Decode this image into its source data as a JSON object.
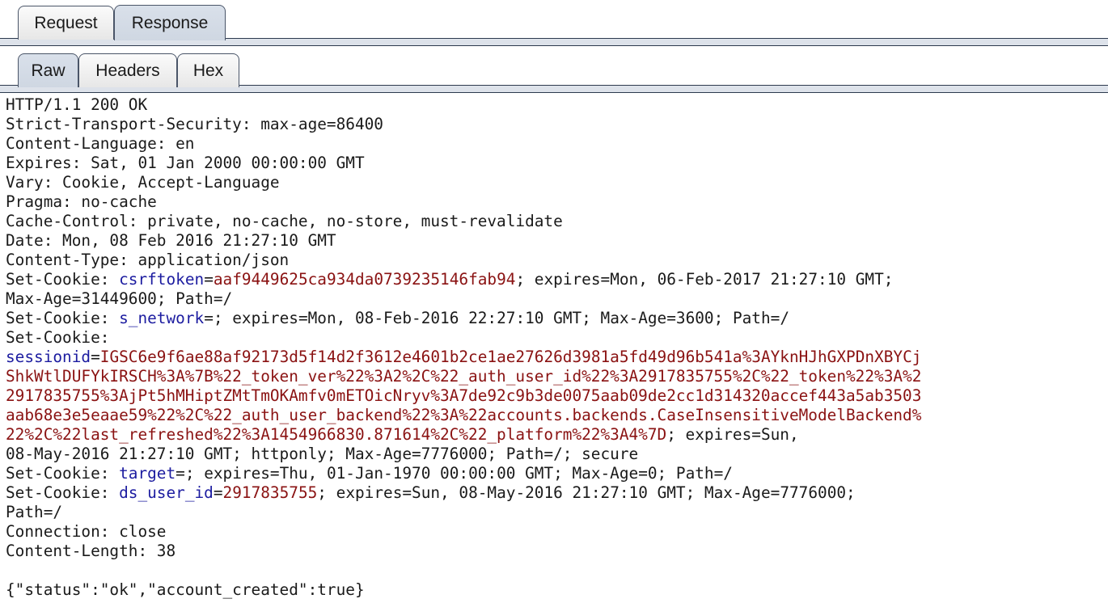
{
  "tabs": {
    "main": [
      "Request",
      "Response"
    ],
    "main_selected": "Response",
    "view": [
      "Raw",
      "Headers",
      "Hex"
    ],
    "view_selected": "Raw"
  },
  "colors": {
    "cookie_name": "#1c1ca0",
    "cookie_value": "#8a1212",
    "selected_tab": "#d3dae4"
  },
  "response": {
    "status_line": "HTTP/1.1 200 OK",
    "headers_before_cookies": [
      "Strict-Transport-Security: max-age=86400",
      "Content-Language: en",
      "Expires: Sat, 01 Jan 2000 00:00:00 GMT",
      "Vary: Cookie, Accept-Language",
      "Pragma: no-cache",
      "Cache-Control: private, no-cache, no-store, must-revalidate",
      "Date: Mon, 08 Feb 2016 21:27:10 GMT",
      "Content-Type: application/json"
    ],
    "set_cookie_prefix": "Set-Cookie:",
    "cookies": [
      {
        "name": "csrftoken",
        "value": "aaf9449625ca934da0739235146fab94",
        "attributes": "; expires=Mon, 06-Feb-2017 21:27:10 GMT; Max-Age=31449600; Path=/"
      },
      {
        "name": "s_network",
        "value": "",
        "attributes": "; expires=Mon, 08-Feb-2016 22:27:10 GMT; Max-Age=3600; Path=/"
      },
      {
        "name": "sessionid",
        "value": "IGSC6e9f6ae88af92173d5f14d2f3612e4601b2ce1ae27626d3981a5fd49d96b541a%3AYknHJhGXPDnXBYCjShkWtlDUFYkIRSCH%3A%7B%22_token_ver%22%3A2%2C%22_auth_user_id%22%3A2917835755%2C%22_token%22%3A%22917835755%3AjPt5hMHiptZMtTmOKAmfv0mETOicNryv%3A7de92c9b3de0075aab09de2cc1d314320accef443a5ab3503aab68e3e5eaae59%22%2C%22_auth_user_backend%22%3A%22accounts.backends.CaseInsensitiveModelBackend%22%2C%22last_refreshed%22%3A1454966830.871614%2C%22_platform%22%3A4%7D",
        "attributes": "; expires=Sun, 08-May-2016 21:27:10 GMT; httponly; Max-Age=7776000; Path=/; secure"
      },
      {
        "name": "target",
        "value": "",
        "attributes": "; expires=Thu, 01-Jan-1970 00:00:00 GMT; Max-Age=0; Path=/"
      },
      {
        "name": "ds_user_id",
        "value": "2917835755",
        "attributes": "; expires=Sun, 08-May-2016 21:27:10 GMT; Max-Age=7776000; Path=/"
      }
    ],
    "headers_after_cookies": [
      "Connection: close",
      "Content-Length: 38"
    ],
    "body": "{\"status\":\"ok\",\"account_created\":true}"
  }
}
